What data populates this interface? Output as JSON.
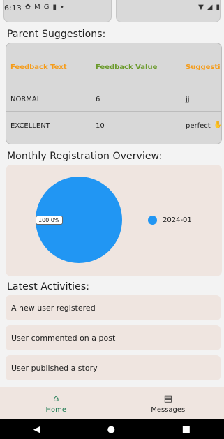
{
  "status_bar": {
    "time": "6:13",
    "left_icons": [
      "gear-icon",
      "mail-icon",
      "google-icon",
      "sd-card-icon",
      "dot-icon"
    ],
    "right_icons": [
      "wifi-icon",
      "signal-icon",
      "battery-icon"
    ]
  },
  "sections": {
    "parent_suggestions": "Parent Suggestions:",
    "monthly_overview": "Monthly Registration Overview:",
    "latest_activities": "Latest Activities:"
  },
  "table": {
    "headers": [
      "Feedback Text",
      "Feedback Value",
      "Suggestic"
    ],
    "header_colors": [
      "#f59c1a",
      "#6a9a2a",
      "#f59c1a"
    ],
    "rows": [
      {
        "text": "NORMAL",
        "value": "6",
        "suggestion": "jj"
      },
      {
        "text": "EXCELLENT",
        "value": "10",
        "suggestion": "perfect"
      }
    ]
  },
  "chart_data": {
    "type": "pie",
    "categories": [
      "2024-01"
    ],
    "values": [
      100
    ],
    "labels": [
      "100.0%"
    ],
    "colors": [
      "#2196f3"
    ],
    "legend_position": "right"
  },
  "activities": [
    "A new user registered",
    "User commented on a post",
    "User published a story"
  ],
  "nav": {
    "home_label": "Home",
    "messages_label": "Messages",
    "home_color": "#1d7a52"
  }
}
